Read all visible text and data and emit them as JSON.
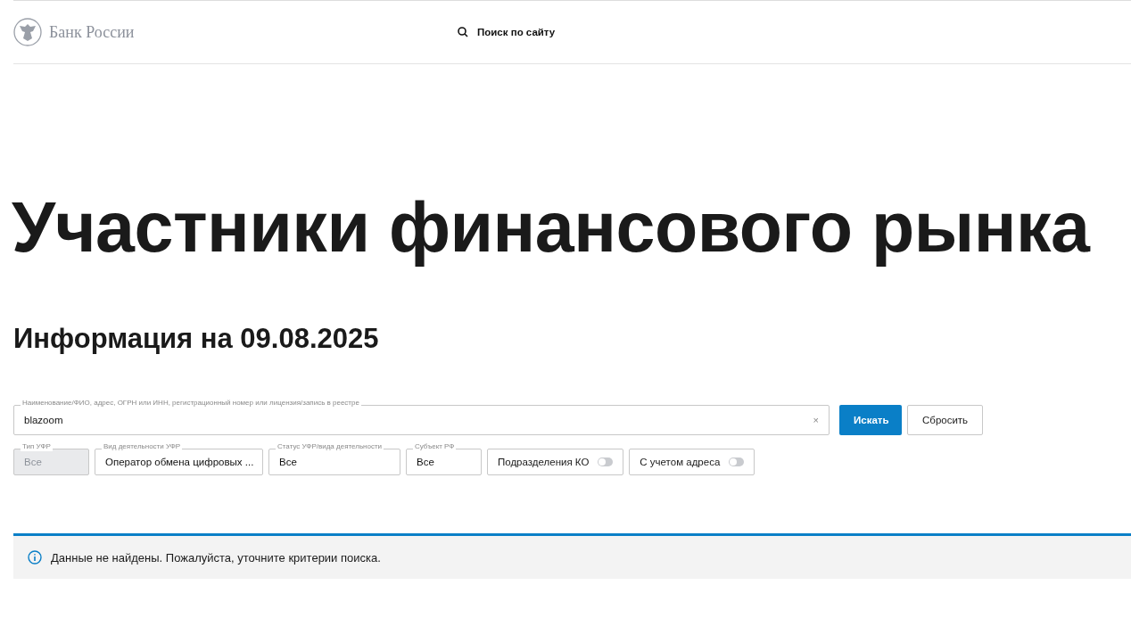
{
  "header": {
    "logo_text": "Банк России",
    "search_label": "Поиск по сайту"
  },
  "title": "Участники финансового рынка",
  "subtitle": "Информация на 09.08.2025",
  "search": {
    "label": "Наименование/ФИО, адрес, ОГРН или ИНН, регистрационный номер или лицензия/запись в реестре",
    "value": "blazoom",
    "clear": "×"
  },
  "buttons": [
    {
      "label": "Искать",
      "kind": "primary"
    },
    {
      "label": "Сбросить",
      "kind": "secondary"
    }
  ],
  "filters": [
    {
      "kind": "select",
      "label": "Тип УФР",
      "value": "Все",
      "disabled": true
    },
    {
      "kind": "select",
      "label": "Вид деятельности УФР",
      "value": "Оператор обмена цифровых ...",
      "disabled": false
    },
    {
      "kind": "select",
      "label": "Статус УФР/вида деятельности",
      "value": "Все",
      "disabled": false
    },
    {
      "kind": "select",
      "label": "Субъект РФ",
      "value": "Все",
      "disabled": false
    },
    {
      "kind": "toggle",
      "label": "Подразделения КО",
      "on": false
    },
    {
      "kind": "toggle",
      "label": "С учетом адреса",
      "on": false
    }
  ],
  "message": "Данные не найдены. Пожалуйста, уточните критерии поиска."
}
